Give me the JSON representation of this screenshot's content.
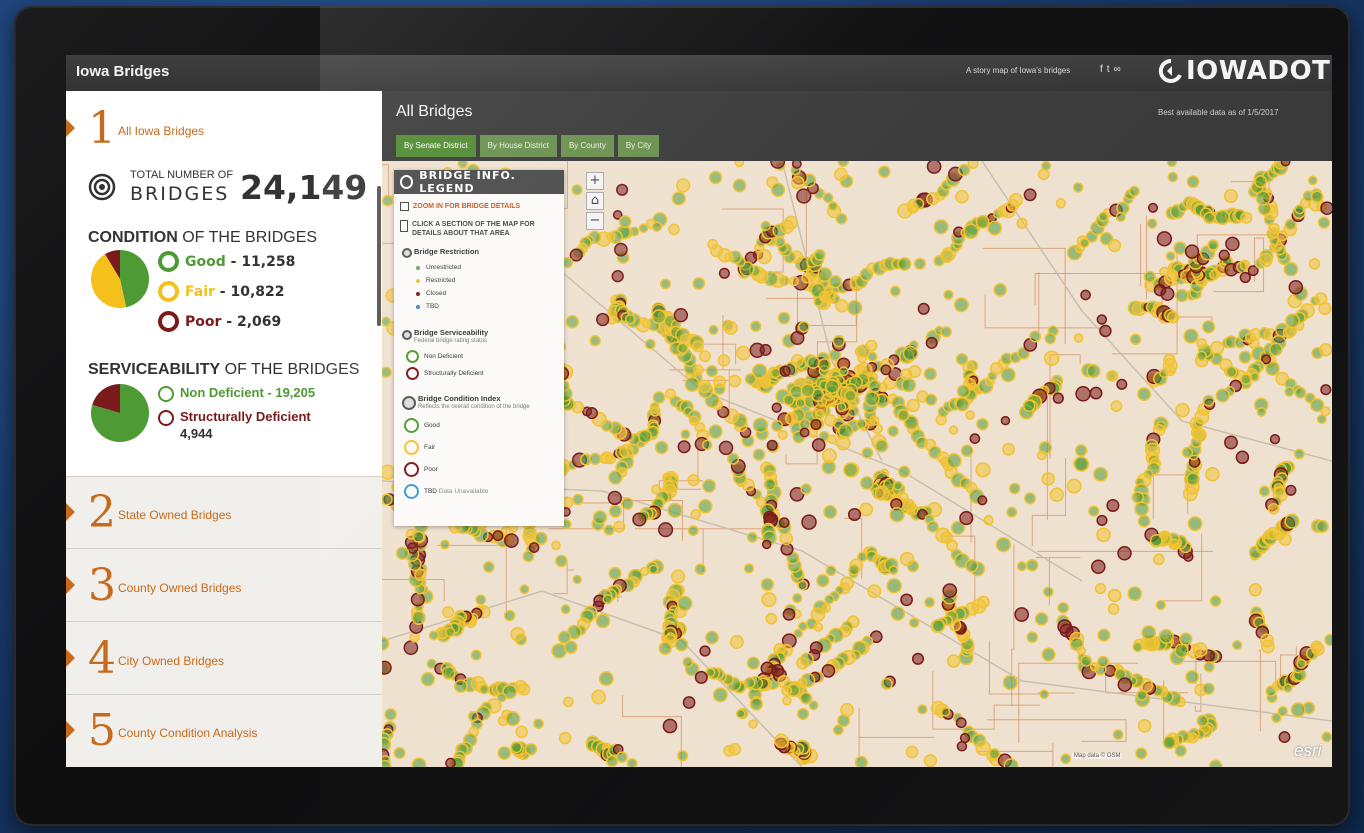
{
  "header": {
    "title": "Iowa Bridges",
    "tagline": "A story map of Iowa's bridges",
    "logo_text": "IOWADOT"
  },
  "sidebar": {
    "sections": [
      {
        "number": "1",
        "label": "All Iowa Bridges"
      },
      {
        "number": "2",
        "label": "State Owned Bridges"
      },
      {
        "number": "3",
        "label": "County Owned Bridges"
      },
      {
        "number": "4",
        "label": "City Owned Bridges"
      },
      {
        "number": "5",
        "label": "County Condition Analysis"
      }
    ],
    "total": {
      "small": "TOTAL NUMBER OF",
      "big": "BRIDGES",
      "value": "24,149"
    },
    "condition": {
      "title_bold": "CONDITION",
      "title_rest": "OF THE BRIDGES",
      "items": [
        {
          "label": "Good",
          "value": "11,258",
          "color": "#4e9a34"
        },
        {
          "label": "Fair",
          "value": "10,822",
          "color": "#f4c01c"
        },
        {
          "label": "Poor",
          "value": "2,069",
          "color": "#7a1a1a"
        }
      ]
    },
    "serviceability": {
      "title_bold": "SERVICEABILITY",
      "title_rest": "OF THE BRIDGES",
      "items": [
        {
          "label": "Non Deficient - 19,205",
          "color": "#4e9a34"
        },
        {
          "label": "Structurally Deficient",
          "value": "4,944",
          "color": "#7a1a1a"
        }
      ]
    }
  },
  "main": {
    "title": "All Bridges",
    "data_note": "Best available data as of 1/5/2017",
    "tabs": [
      {
        "label": "By Senate District",
        "active": true
      },
      {
        "label": "By House District",
        "active": false
      },
      {
        "label": "By County",
        "active": false
      },
      {
        "label": "By City",
        "active": false
      }
    ]
  },
  "legend": {
    "title": "BRIDGE INFO. LEGEND",
    "zoom_note": "ZOOM IN FOR BRIDGE DETAILS",
    "click_note": "CLICK A SECTION OF THE MAP FOR DETAILS ABOUT THAT AREA",
    "restriction": {
      "title": "Bridge Restriction",
      "items": [
        {
          "label": "Unrestricted",
          "color": "#6aa84f"
        },
        {
          "label": "Restricted",
          "color": "#f1c232"
        },
        {
          "label": "Closed",
          "color": "#7a1a1a"
        },
        {
          "label": "TBD",
          "color": "#3d85c6"
        }
      ]
    },
    "serviceability": {
      "title": "Bridge Serviceability",
      "subtitle": "Federal bridge rating status",
      "items": [
        {
          "label": "Non Deficient",
          "color": "#4e9a34"
        },
        {
          "label": "Structurally Deficient",
          "color": "#7a1a1a"
        }
      ]
    },
    "condition": {
      "title": "Bridge Condition Index",
      "subtitle": "Reflects the overall condition of the bridge",
      "items": [
        {
          "label": "Good",
          "color": "#4e9a34"
        },
        {
          "label": "Fair",
          "color": "#f1c232"
        },
        {
          "label": "Poor",
          "color": "#7a1a1a"
        },
        {
          "label": "TBD",
          "extra": "Data Unavailable",
          "color": "#3d9ad6"
        }
      ]
    }
  },
  "map": {
    "zoom_in": "+",
    "home": "⌂",
    "zoom_out": "−",
    "attribution": "Map data © OSM",
    "esri": "esri"
  }
}
